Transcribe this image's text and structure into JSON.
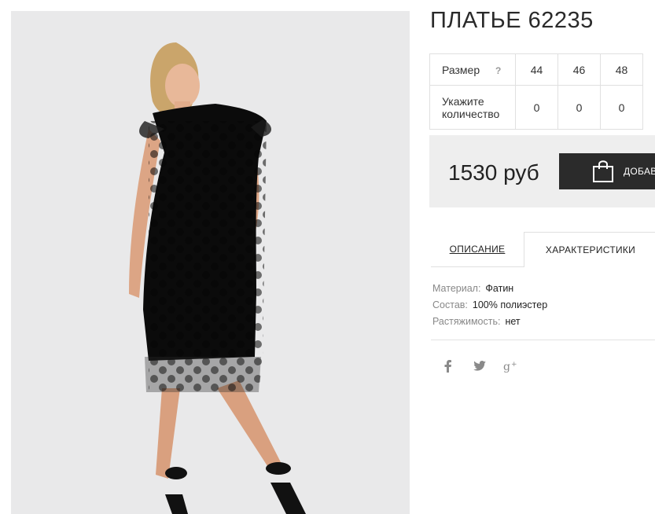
{
  "product": {
    "title": "ПЛАТЬЕ 62235",
    "image_alt": "black polka dot mesh dress"
  },
  "size_table": {
    "size_label": "Размер",
    "help_glyph": "?",
    "sizes": [
      "44",
      "46",
      "48"
    ],
    "qty_label_line1": "Укажите",
    "qty_label_line2": "количество",
    "quantities": [
      "0",
      "0",
      "0"
    ]
  },
  "purchase": {
    "price": "1530 руб",
    "add_button_label": "ДОБАВ"
  },
  "tabs": {
    "description": "ОПИСАНИЕ",
    "characteristics": "ХАРАКТЕРИСТИКИ",
    "active": "characteristics"
  },
  "specs": [
    {
      "key": "Материал:",
      "value": "Фатин"
    },
    {
      "key": "Состав:",
      "value": "100% полиэстер"
    },
    {
      "key": "Растяжимость:",
      "value": "нет"
    }
  ],
  "social": [
    {
      "icon": "facebook-icon",
      "glyph": "f"
    },
    {
      "icon": "twitter-icon",
      "glyph": "🐦"
    },
    {
      "icon": "google-plus-icon",
      "glyph": "g+"
    }
  ],
  "colors": {
    "button_bg": "#2b2b2b",
    "price_box_bg": "#eeeeee",
    "photo_bg": "#e9e9ea"
  }
}
